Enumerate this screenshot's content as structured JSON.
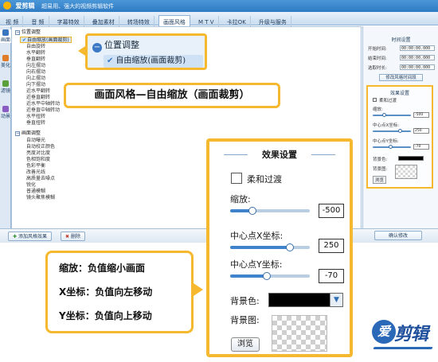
{
  "app": {
    "name": "爱剪辑",
    "slogan": "超易用、强大的视频剪辑软件"
  },
  "tabs": [
    "视 频",
    "音 频",
    "字幕特效",
    "叠加素材",
    "转场特效",
    "画面风格",
    "M T V",
    "卡拉OK",
    "升级与服务"
  ],
  "active_tab": "画面风格",
  "side_tabs": [
    "画面",
    "美化",
    "滤镜",
    "动景"
  ],
  "tree": {
    "group1": "位置调整",
    "items": [
      "自由缩放(画面裁剪)",
      "自由旋转",
      "水平翻转",
      "垂直翻转",
      "向左摆动",
      "向右摆动",
      "向上摆动",
      "向下摆动",
      "近水平翻转",
      "近垂直翻转",
      "近水平中轴转动",
      "近垂直中轴转动",
      "水平扭转",
      "垂直扭转"
    ],
    "group2": "画面调整",
    "items2": [
      "自动曝光",
      "自动校正颜色",
      "亮度对比度",
      "色相饱和度",
      "色彩平衡",
      "改善光线",
      "高质量去噪点",
      "锐化",
      "普通模糊",
      "镜头聚焦模糊"
    ]
  },
  "bottom": {
    "add_button": "添加风格效果",
    "delete_button": "删除",
    "confirm_button": "确认修改"
  },
  "time_settings": {
    "title": "时间设置",
    "start_label": "开始时间:",
    "start_value": "00:00:00.000",
    "end_label": "结束时间:",
    "end_value": "00:00:00.000",
    "duration_label": "选取时长:",
    "duration_value": "00:00:00.000",
    "button": "修改风格时间段"
  },
  "mini_effects": {
    "title": "效果设置",
    "soft_label": "柔和过渡",
    "zoom_label": "缩放:",
    "zoom_value": "-500",
    "x_label": "中心点X坐标:",
    "x_value": "250",
    "y_label": "中心点Y坐标:",
    "y_value": "-70",
    "bg_color_label": "背景色:",
    "bg_image_label": "背景图:",
    "browse": "浏览"
  },
  "callout": {
    "group": "位置调整",
    "item": "自由缩放(画面裁剪)"
  },
  "banner": "画面风格—自由缩放（画面裁剪）",
  "effects": {
    "title": "效果设置",
    "soft_label": "柔和过渡",
    "zoom_label": "缩放:",
    "zoom_value": "-500",
    "zoom_level": 0.28,
    "x_label": "中心点X坐标:",
    "x_value": "250",
    "x_level": 0.75,
    "y_label": "中心点Y坐标:",
    "y_value": "-70",
    "y_level": 0.46,
    "bg_color_label": "背景色:",
    "bg_color": "#000000",
    "bg_image_label": "背景图:",
    "browse": "浏览"
  },
  "notes": [
    "缩放：负值缩小画面",
    "X坐标：负值向左移动",
    "Y坐标：负值向上移动"
  ],
  "watermark": {
    "mark": "爱",
    "text": "剪辑"
  },
  "colors": {
    "accent": "#f5b82e",
    "title_blue": "#2f7bc4"
  }
}
